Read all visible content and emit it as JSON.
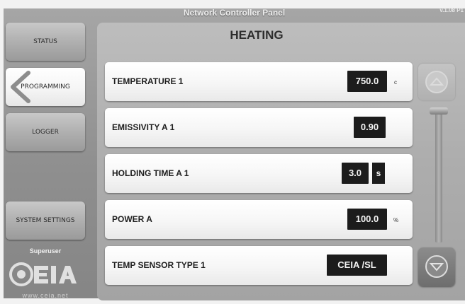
{
  "header": {
    "title": "Network Controller Panel",
    "version": "v.1.08 P1"
  },
  "sidebar": {
    "items": [
      {
        "label": "STATUS"
      },
      {
        "label": "PROGRAMMING"
      },
      {
        "label": "LOGGER"
      },
      {
        "label": "SYSTEM SETTINGS"
      }
    ],
    "user_level": "Superuser",
    "logo_text": "CEIA",
    "website": "www.ceia.net"
  },
  "panel": {
    "title": "HEATING",
    "rows": [
      {
        "label": "TEMPERATURE 1",
        "value": "750.0",
        "unit": "c"
      },
      {
        "label": "EMISSIVITY A 1",
        "value": "0.90"
      },
      {
        "label": "HOLDING TIME A 1",
        "value": "3.0",
        "unit": "s"
      },
      {
        "label": "POWER A",
        "value": "100.0",
        "unit": "%"
      },
      {
        "label": "TEMP SENSOR TYPE 1",
        "value": "CEIA /SL"
      }
    ]
  },
  "colors": {
    "value_box": "#1c1c1c",
    "background": "#9a9a9a",
    "row": "#f6f6f6"
  }
}
